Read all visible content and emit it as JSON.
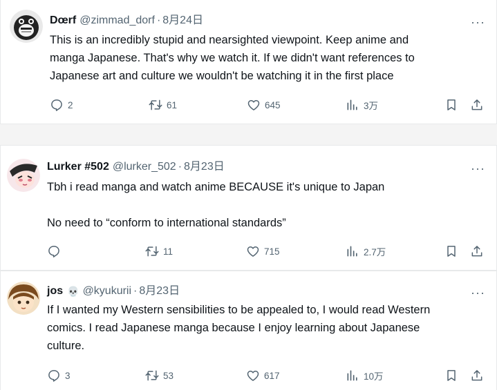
{
  "tweets": [
    {
      "name": "Dœrf",
      "handle": "@zimmad_dorf",
      "separator": "·",
      "date": "8月24日",
      "text_lines": [
        "This is an incredibly stupid and nearsighted viewpoint. Keep anime and",
        "manga Japanese. That's why we watch it. If we didn't want references to",
        "Japanese art and culture we wouldn't be watching it in the first place"
      ],
      "replies": "2",
      "retweets": "61",
      "likes": "645",
      "views": "3万"
    },
    {
      "name": "Lurker #502",
      "handle": "@lurker_502",
      "separator": "·",
      "date": "8月23日",
      "paragraph1": "Tbh i read manga and watch anime BECAUSE it's unique to Japan",
      "paragraph2": "No need to “conform to international standards”",
      "replies": "",
      "retweets": "11",
      "likes": "715",
      "views": "2.7万"
    },
    {
      "name": "jos",
      "name_emoji": "💀",
      "handle": "@kyukurii",
      "separator": "·",
      "date": "8月23日",
      "text_lines": [
        "If I wanted my Western sensibilities to be appealed to, I would read Western",
        "comics. I read Japanese manga because I enjoy learning about Japanese",
        "culture."
      ],
      "replies": "3",
      "retweets": "53",
      "likes": "617",
      "views": "10万"
    }
  ],
  "more_label": "···",
  "icons": [
    "reply-icon",
    "retweet-icon",
    "like-icon",
    "views-icon",
    "bookmark-icon",
    "share-icon"
  ],
  "colors": {
    "text": "#0f1419",
    "muted": "#536471",
    "border": "#e7e9ea"
  }
}
